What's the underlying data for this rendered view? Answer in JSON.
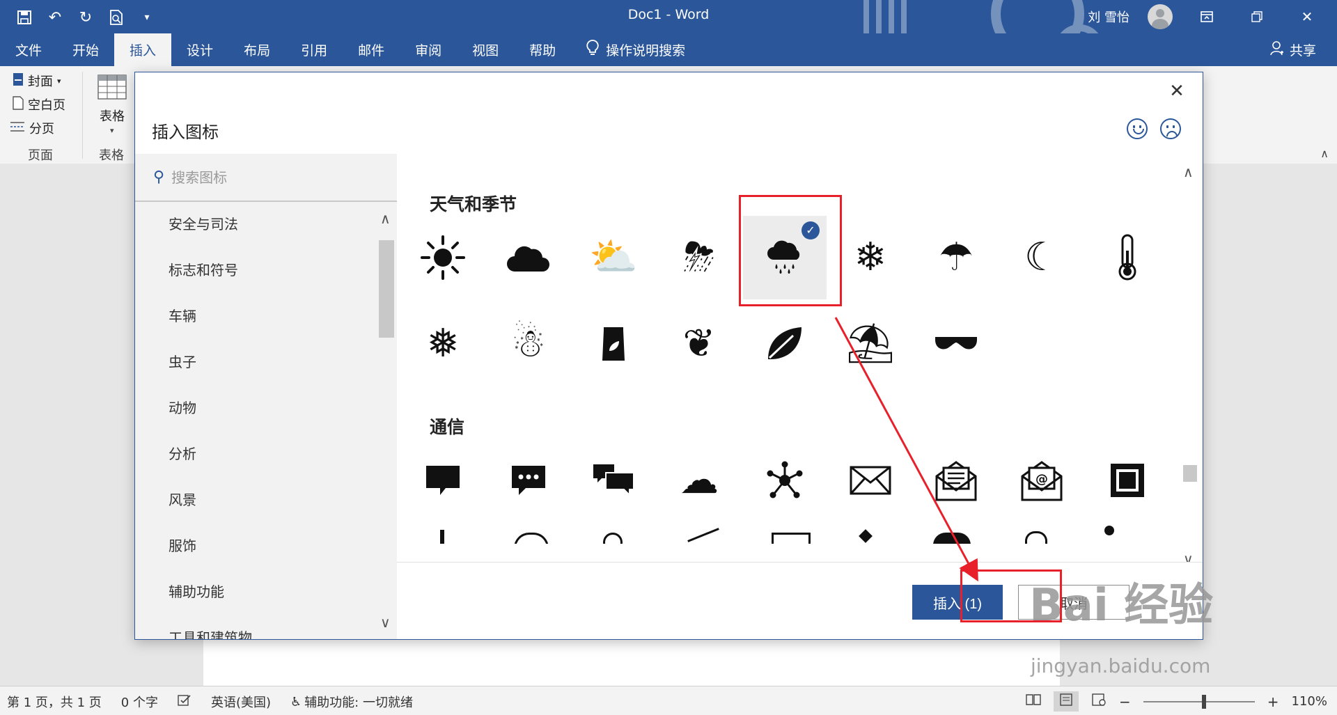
{
  "window": {
    "title": "Doc1  -  Word",
    "user_name": "刘 雪怡",
    "qat_icons": [
      "save-icon",
      "undo-icon",
      "redo-icon",
      "print-preview-icon",
      "customize-icon"
    ],
    "win_icons": [
      "ribbon-display-icon",
      "restore-icon",
      "close-icon"
    ]
  },
  "menu": {
    "tabs": [
      "文件",
      "开始",
      "插入",
      "设计",
      "布局",
      "引用",
      "邮件",
      "审阅",
      "视图",
      "帮助"
    ],
    "active_tab": "插入",
    "tell_me": "操作说明搜索",
    "share": "共享"
  },
  "ribbon": {
    "cover": "封面",
    "blank_page": "空白页",
    "page_break": "分页",
    "pages_group": "页面",
    "table": "表格",
    "tables_group": "表格"
  },
  "dialog": {
    "title": "插入图标",
    "search_placeholder": "搜索图标",
    "categories": [
      "安全与司法",
      "标志和符号",
      "车辆",
      "虫子",
      "动物",
      "分析",
      "风景",
      "服饰",
      "辅助功能",
      "工具和建筑物"
    ],
    "sections": {
      "weather_title": "天气和季节",
      "comm_title": "通信"
    },
    "weather_icons": [
      {
        "name": "sun-icon",
        "glyph": "☀"
      },
      {
        "name": "cloud-icon",
        "glyph": "☁"
      },
      {
        "name": "sun-behind-cloud-icon",
        "glyph": "⛅"
      },
      {
        "name": "thunderstorm-icon",
        "glyph": "⛈"
      },
      {
        "name": "rain-cloud-icon",
        "glyph": "☔"
      },
      {
        "name": "snow-cloud-icon",
        "glyph": "❄"
      },
      {
        "name": "umbrella-icon",
        "glyph": "☂"
      },
      {
        "name": "moon-stars-icon",
        "glyph": "☾"
      },
      {
        "name": "thermometer-icon",
        "glyph": "🌡"
      },
      {
        "name": "snowflake-icon",
        "glyph": "❅"
      },
      {
        "name": "snowman-icon",
        "glyph": "☃"
      },
      {
        "name": "seed-bag-icon",
        "glyph": "▮"
      },
      {
        "name": "sprout-icon",
        "glyph": "❦"
      },
      {
        "name": "leaf-icon",
        "glyph": "❧"
      },
      {
        "name": "beach-umbrella-icon",
        "glyph": "⛱"
      },
      {
        "name": "sunglasses-icon",
        "glyph": "▀▀"
      }
    ],
    "comm_icons": [
      {
        "name": "speech-bubble-icon",
        "glyph": "▆"
      },
      {
        "name": "chat-dots-icon",
        "glyph": "⋯"
      },
      {
        "name": "conversation-icon",
        "glyph": "▇"
      },
      {
        "name": "thought-bubble-icon",
        "glyph": "☁"
      },
      {
        "name": "network-hub-icon",
        "glyph": "✸"
      },
      {
        "name": "envelope-icon",
        "glyph": "✉"
      },
      {
        "name": "open-letter-icon",
        "glyph": "✉"
      },
      {
        "name": "email-at-icon",
        "glyph": "@"
      },
      {
        "name": "stamp-icon",
        "glyph": "▣"
      }
    ],
    "selected_icon": "rain-cloud-icon",
    "insert_label": "插入 (1)",
    "cancel_label": "取消"
  },
  "status": {
    "page": "第 1 页，共 1 页",
    "words": "0 个字",
    "language": "英语(美国)",
    "accessibility": "辅助功能: 一切就绪",
    "zoom": "110%",
    "zoom_level": 0.55
  },
  "watermark": {
    "main": "Bai 经验",
    "sub": "jingyan.baidu.com"
  },
  "colors": {
    "accent": "#2b579a",
    "highlight": "#e8202a"
  }
}
